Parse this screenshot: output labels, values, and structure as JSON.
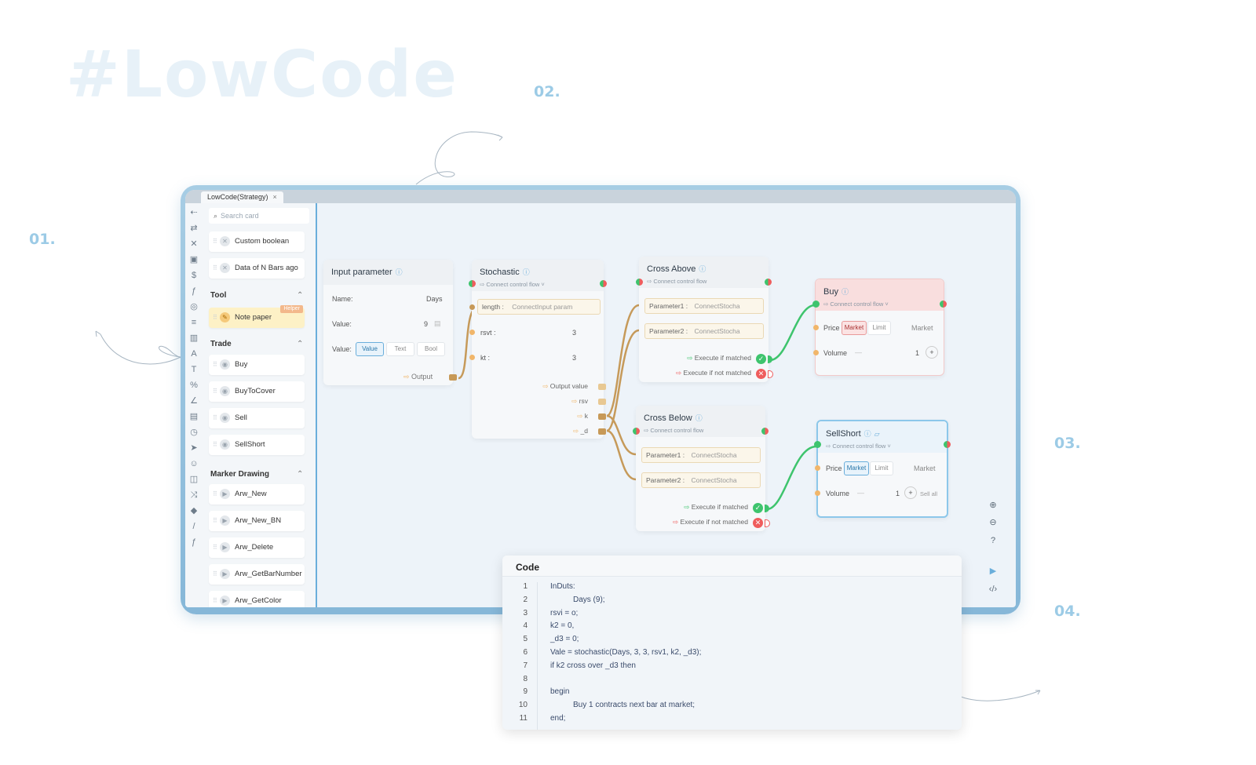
{
  "hero": {
    "title": "#LowCode"
  },
  "steps": [
    "01.",
    "02.",
    "03.",
    "04."
  ],
  "window": {
    "tab_label": "LowCode(Strategy)",
    "tab_close": "×"
  },
  "palette": {
    "search_placeholder": "Search card",
    "top_cards": [
      {
        "label": "Custom boolean"
      },
      {
        "label": "Data of N Bars ago"
      }
    ],
    "sections": [
      {
        "title": "Tool",
        "cards": [
          {
            "label": "Note paper",
            "badge": "Helper"
          }
        ]
      },
      {
        "title": "Trade",
        "cards": [
          {
            "label": "Buy"
          },
          {
            "label": "BuyToCover"
          },
          {
            "label": "Sell"
          },
          {
            "label": "SellShort"
          }
        ]
      },
      {
        "title": "Marker Drawing",
        "cards": [
          {
            "label": "Arw_New"
          },
          {
            "label": "Arw_New_BN"
          },
          {
            "label": "Arw_Delete"
          },
          {
            "label": "Arw_GetBarNumber"
          },
          {
            "label": "Arw_GetColor"
          }
        ]
      }
    ]
  },
  "nodes": {
    "input": {
      "title": "Input parameter",
      "name_label": "Name:",
      "name_value": "Days",
      "value_label": "Value:",
      "value_value": "9",
      "type_label": "Value:",
      "types": [
        "Value",
        "Text",
        "Bool"
      ],
      "output_label": "Output"
    },
    "stochastic": {
      "title": "Stochastic",
      "sub": "Connect control flow",
      "length_label": "length :",
      "length_value": "ConnectInput param",
      "rsvt_label": "rsvt :",
      "rsvt_value": "3",
      "kt_label": "kt :",
      "kt_value": "3",
      "outputs": [
        "Output value",
        "rsv",
        "k",
        "_d"
      ]
    },
    "cross_above": {
      "title": "Cross Above",
      "sub": "Connect control flow",
      "p1_label": "Parameter1 :",
      "p1_value": "ConnectStocha",
      "p2_label": "Parameter2 :",
      "p2_value": "ConnectStocha",
      "matched": "Execute if matched",
      "not_matched": "Execute if not matched"
    },
    "cross_below": {
      "title": "Cross Below",
      "sub": "Connect control flow",
      "p1_label": "Parameter1 :",
      "p1_value": "ConnectStocha",
      "p2_label": "Parameter2 :",
      "p2_value": "ConnectStocha",
      "matched": "Execute if matched",
      "not_matched": "Execute if not matched"
    },
    "buy": {
      "title": "Buy",
      "sub": "Connect control flow",
      "price_label": "Price",
      "price_options": [
        "Market",
        "Limit"
      ],
      "price_value": "Market",
      "volume_label": "Volume",
      "volume_value": "1"
    },
    "sellshort": {
      "title": "SellShort",
      "sub": "Connect control flow",
      "price_label": "Price",
      "price_options": [
        "Market",
        "Limit"
      ],
      "price_value": "Market",
      "volume_label": "Volume",
      "volume_value": "1",
      "sell_all": "Sell all"
    }
  },
  "code": {
    "title": "Code",
    "lines": [
      {
        "n": "1",
        "text": "InDuts:",
        "indent": false
      },
      {
        "n": "2",
        "text": "Days (9);",
        "indent": true
      },
      {
        "n": "3",
        "text": "rsvi = o;",
        "indent": false
      },
      {
        "n": "4",
        "text": "k2 = 0,",
        "indent": false
      },
      {
        "n": "5",
        "text": "_d3 = 0;",
        "indent": false
      },
      {
        "n": "6",
        "text": "Vale = stochastic(Days, 3, 3, rsv1, k2, _d3);",
        "indent": false
      },
      {
        "n": "7",
        "text": "if k2 cross over _d3 then",
        "indent": false
      },
      {
        "n": "8",
        "text": "",
        "indent": false
      },
      {
        "n": "9",
        "text": "begin",
        "indent": false
      },
      {
        "n": "10",
        "text": "Buy 1 contracts next bar at market;",
        "indent": true
      },
      {
        "n": "11",
        "text": "end;",
        "indent": false
      }
    ]
  }
}
